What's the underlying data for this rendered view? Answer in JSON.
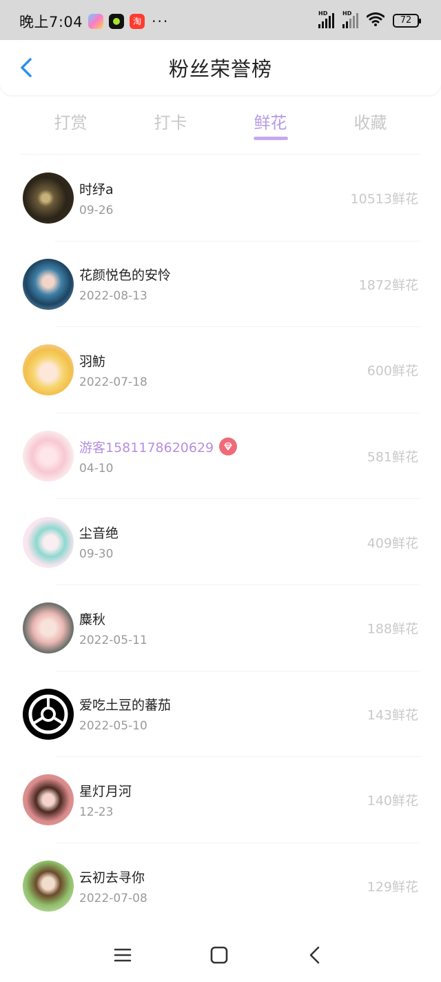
{
  "status_bar": {
    "time": "晚上7:04",
    "more": "···",
    "signal1_label": "HD",
    "signal2_label": "HD",
    "battery": "72",
    "app_icons": [
      "game-center-icon",
      "camera-app-icon",
      "taobao-icon"
    ],
    "taobao_char": "淘"
  },
  "header": {
    "title": "粉丝荣誉榜",
    "back_icon": "chevron-left-icon"
  },
  "tabs": [
    {
      "label": "打赏",
      "active": false
    },
    {
      "label": "打卡",
      "active": false
    },
    {
      "label": "鲜花",
      "active": true
    },
    {
      "label": "收藏",
      "active": false
    }
  ],
  "fans": [
    {
      "name": "时纾a",
      "date": "09-26",
      "count": "10513鲜花",
      "vip": false
    },
    {
      "name": "花颜悦色的安怜",
      "date": "2022-08-13",
      "count": "1872鲜花",
      "vip": false
    },
    {
      "name": "羽魴",
      "date": "2022-07-18",
      "count": "600鲜花",
      "vip": false
    },
    {
      "name": "游客1581178620629",
      "date": "04-10",
      "count": "581鲜花",
      "vip": true
    },
    {
      "name": "尘音绝",
      "date": "09-30",
      "count": "409鲜花",
      "vip": false
    },
    {
      "name": "麋秋",
      "date": "2022-05-11",
      "count": "188鲜花",
      "vip": false
    },
    {
      "name": "爱吃土豆的蕃茄",
      "date": "2022-05-10",
      "count": "143鲜花",
      "vip": false
    },
    {
      "name": "星灯月河",
      "date": "12-23",
      "count": "140鲜花",
      "vip": false
    },
    {
      "name": "云初去寻你",
      "date": "2022-07-08",
      "count": "129鲜花",
      "vip": false
    }
  ],
  "colors": {
    "accent": "#b89be8",
    "vip_name": "#b58fe0",
    "vip_badge": "#f06a78",
    "back_arrow": "#2f8fe8"
  },
  "navbar": {
    "icons": [
      "menu-icon",
      "home-icon",
      "back-icon"
    ]
  }
}
